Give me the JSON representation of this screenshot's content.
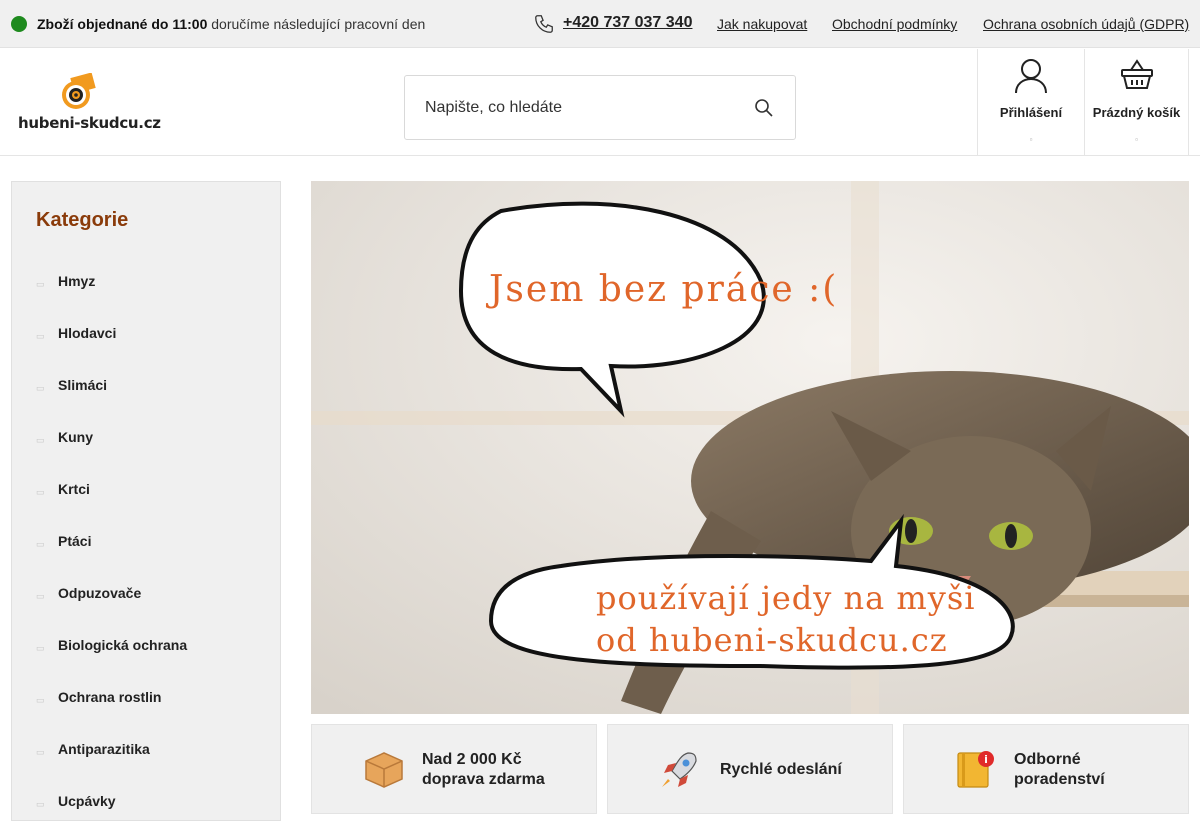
{
  "topbar": {
    "notice_bold": "Zboží objednané do 11:00",
    "notice_rest": " doručíme následující pracovní den",
    "phone": "+420 737 037 340",
    "links": [
      "Jak nakupovat",
      "Obchodní podmínky",
      "Ochrana osobních údajů (GDPR)"
    ]
  },
  "header": {
    "logo_text": "hubeni-skudcu.cz",
    "search_placeholder": "Napište, co hledáte",
    "login_label": "Přihlášení",
    "cart_label": "Prázdný košík",
    "caret": "▫"
  },
  "sidebar": {
    "title": "Kategorie",
    "items": [
      "Hmyz",
      "Hlodavci",
      "Slimáci",
      "Kuny",
      "Krtci",
      "Ptáci",
      "Odpuzovače",
      "Biologická ochrana",
      "Ochrana rostlin",
      "Antiparazitika",
      "Ucpávky"
    ],
    "bullet": "▭"
  },
  "banner": {
    "bubble_top": "Jsem bez práce :(",
    "bubble_bottom_1": "používají jedy na myši",
    "bubble_bottom_2": "od hubeni-skudcu.cz"
  },
  "benefits": [
    {
      "line1": "Nad 2 000 Kč",
      "line2": "doprava zdarma",
      "icon": "box-icon"
    },
    {
      "line1": "Rychlé odeslání",
      "line2": "",
      "icon": "rocket-icon"
    },
    {
      "line1": "Odborné",
      "line2": "poradenství",
      "icon": "book-info-icon"
    }
  ],
  "colors": {
    "accent": "#8a3b0a",
    "status_green": "#1e8a1e",
    "banner_text": "#e0662a"
  }
}
